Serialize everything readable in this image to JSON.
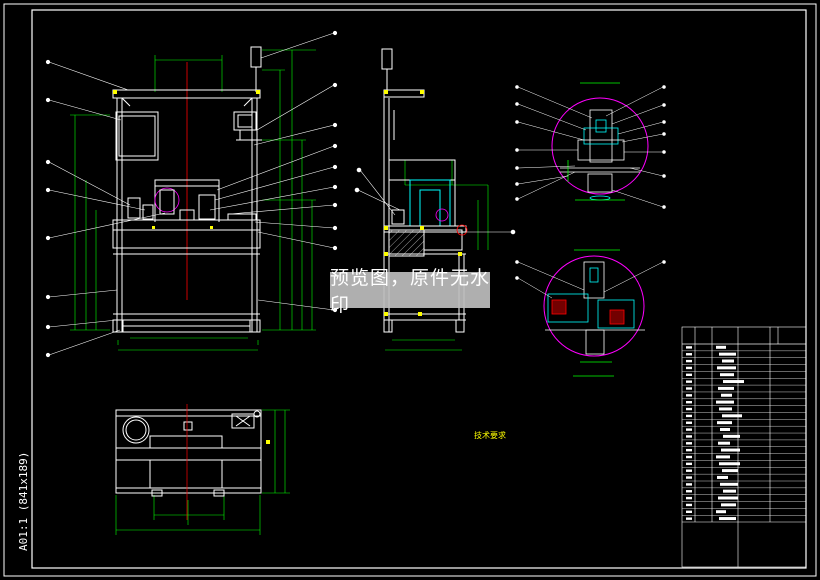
{
  "watermark": {
    "text": "预览图，原件无水印"
  },
  "side_label": {
    "text": "A01:1 (841x189)"
  },
  "tech_requirements": {
    "title": "技术要求"
  },
  "colors": {
    "background": "#000000",
    "frame": "#ffffff",
    "structure": "#ffffff",
    "dimension": "#00ff00",
    "centerline": "#ff0000",
    "part_cyan": "#00ffff",
    "detail_circle": "#ff00ff",
    "joint": "#ffff00",
    "watermark_bg": "#bebebe"
  },
  "icons": {
    "detail_view": "magenta-detail-circle",
    "leader": "balloon-leader-line",
    "hatch": "section-hatch"
  }
}
